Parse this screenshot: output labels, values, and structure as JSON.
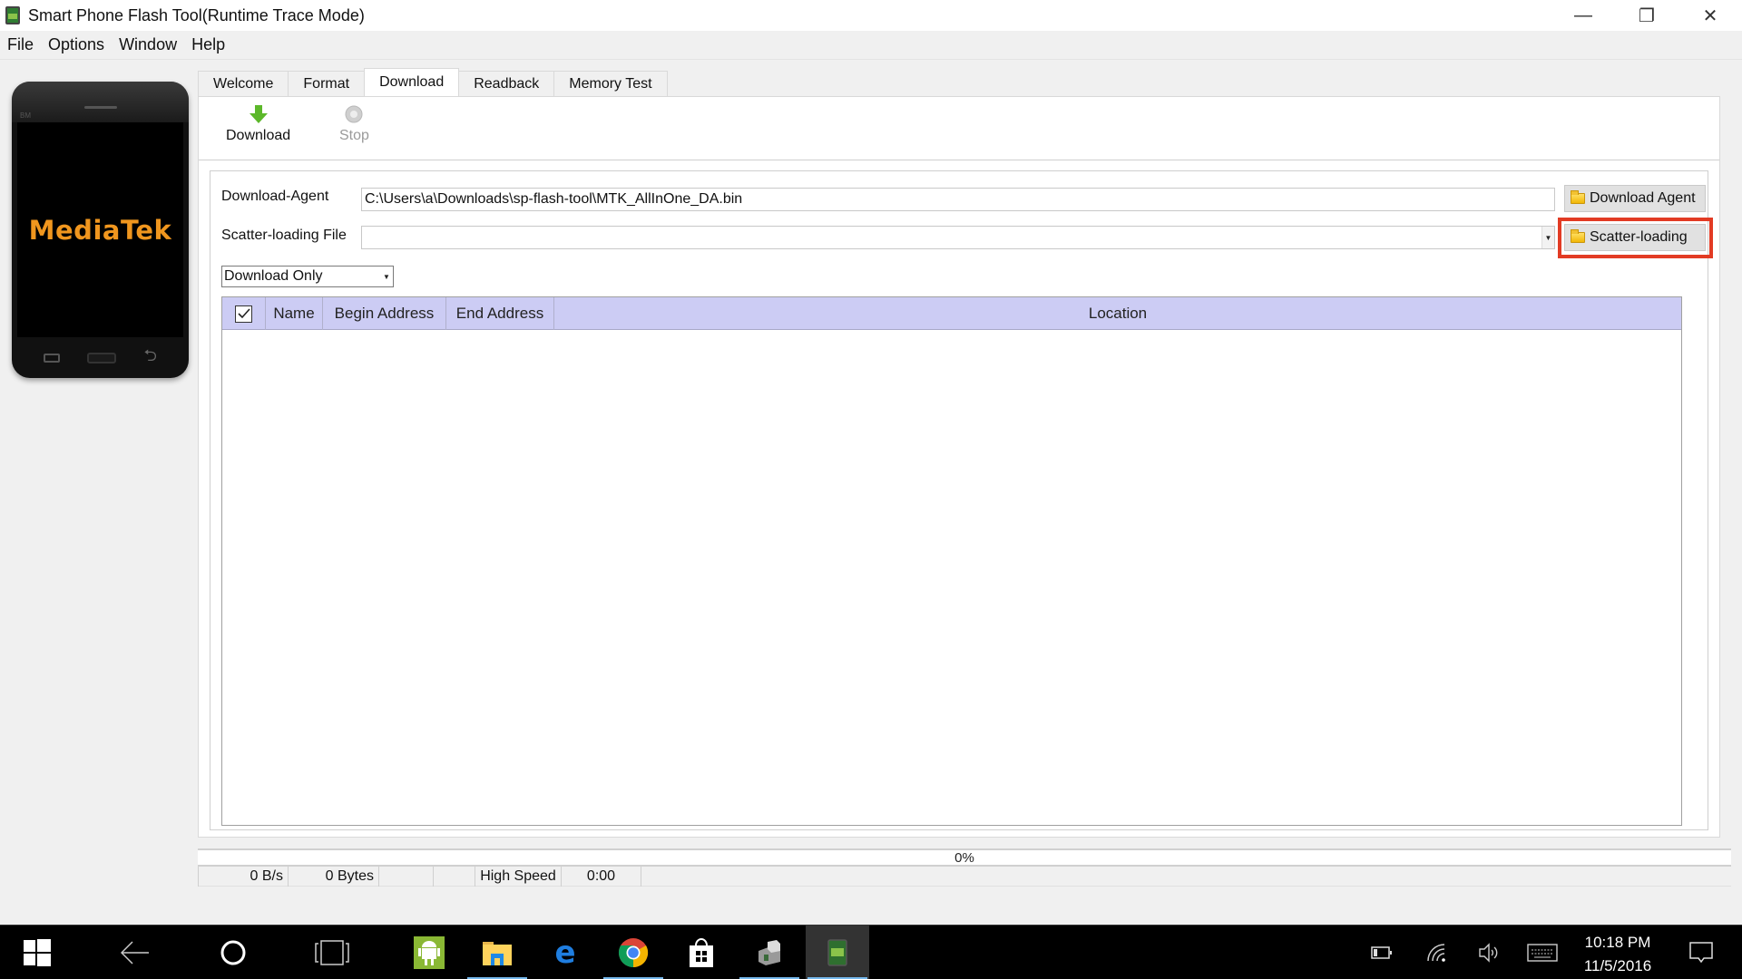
{
  "window": {
    "title": "Smart Phone Flash Tool(Runtime Trace Mode)",
    "controls": {
      "minimize": "—",
      "restore": "❐",
      "close": "✕"
    }
  },
  "menu": [
    "File",
    "Options",
    "Window",
    "Help"
  ],
  "phone": {
    "brand": "MediaTek",
    "carrier_label": "BM"
  },
  "tabs": [
    {
      "label": "Welcome",
      "active": false
    },
    {
      "label": "Format",
      "active": false
    },
    {
      "label": "Download",
      "active": true
    },
    {
      "label": "Readback",
      "active": false
    },
    {
      "label": "Memory Test",
      "active": false
    }
  ],
  "toolbar": {
    "download": {
      "label": "Download",
      "icon": "down-arrow-icon",
      "color": "#5cb82a"
    },
    "stop": {
      "label": "Stop",
      "icon": "stop-icon",
      "enabled": false
    }
  },
  "form": {
    "download_agent": {
      "label": "Download-Agent",
      "value": "C:\\Users\\a\\Downloads\\sp-flash-tool\\MTK_AllInOne_DA.bin",
      "button": "Download Agent"
    },
    "scatter_file": {
      "label": "Scatter-loading File",
      "value": "",
      "button": "Scatter-loading",
      "highlighted": true,
      "highlight_color": "#e23b24"
    },
    "mode": {
      "selected": "Download Only"
    }
  },
  "table": {
    "header_checked": true,
    "columns": [
      "Name",
      "Begin Address",
      "End Address",
      "Location"
    ],
    "rows": [],
    "header_color": "#ccccf4"
  },
  "progress": {
    "percent": 0,
    "label": "0%"
  },
  "status": {
    "speed": "0 B/s",
    "bytes": "0 Bytes",
    "cell3": "",
    "cell4": "",
    "connection": "High Speed",
    "time": "0:00"
  },
  "taskbar": {
    "apps": [
      "start",
      "back",
      "cortana",
      "task-view",
      "android-studio",
      "file-explorer",
      "edge",
      "chrome",
      "store",
      "flash-tool-2",
      "smart-phone-flash-tool"
    ],
    "time": "10:18 PM",
    "date": "11/5/2016"
  }
}
